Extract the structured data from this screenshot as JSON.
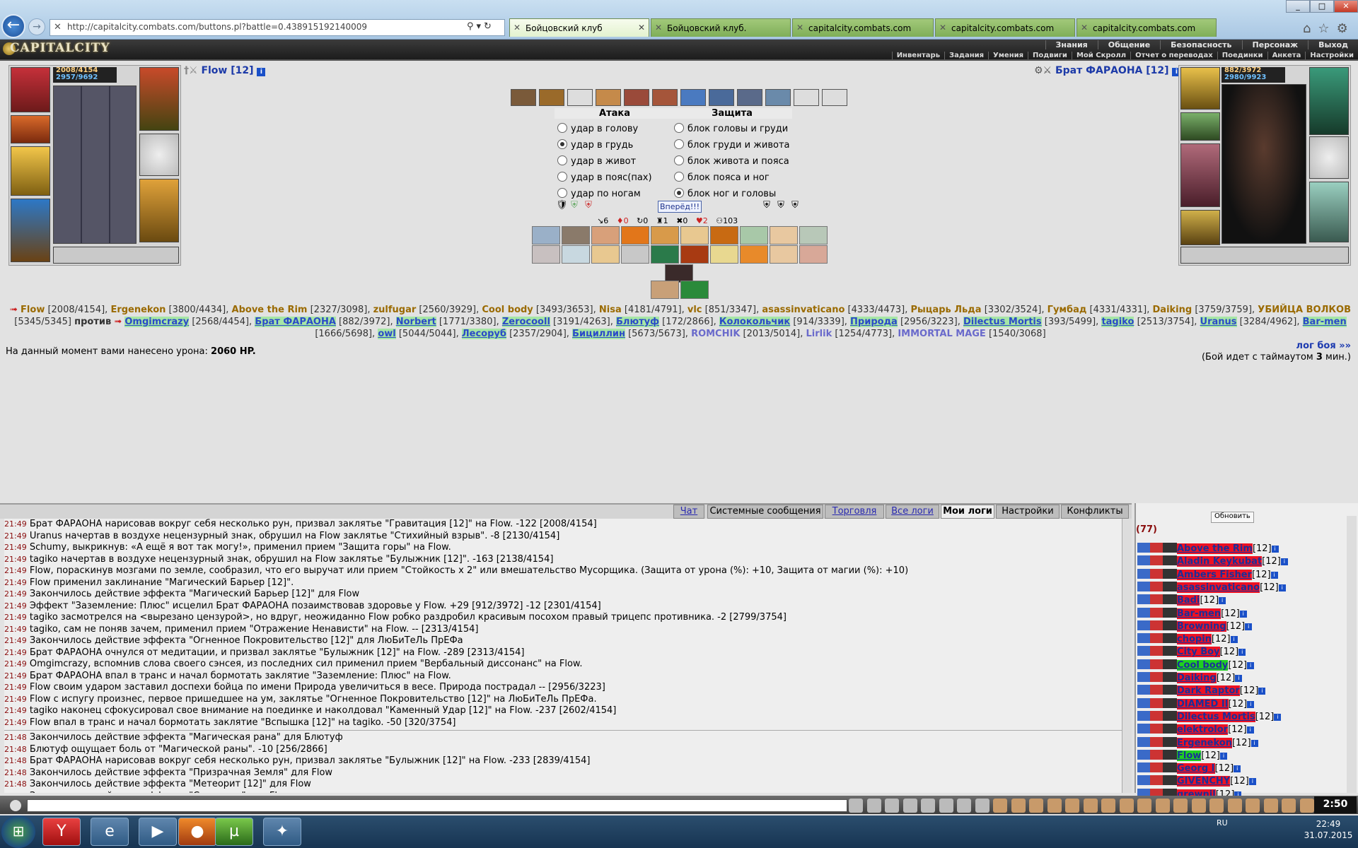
{
  "browser": {
    "url": "http://capitalcity.combats.com/buttons.pl?battle=0.438915192140009",
    "tabs": [
      "Бойцовский клуб",
      "Бойцовский клуб.",
      "capitalcity.combats.com",
      "capitalcity.combats.com",
      "capitalcity.combats.com"
    ]
  },
  "game": {
    "logo": "CAPITALCITY",
    "menu": [
      "Знания",
      "Общение",
      "Безопасность",
      "Персонаж",
      "Выход"
    ],
    "submenu": [
      "Инвентарь",
      "Задания",
      "Умения",
      "Подвиги",
      "Мой Скролл",
      "Отчет о переводах",
      "Поединки",
      "Анкета",
      "Настройки"
    ]
  },
  "left_char": {
    "name": "Flow [12]",
    "hp": "2008/4154",
    "mp": "2957/9692"
  },
  "right_char": {
    "name": "Брат ФАРАОНА [12]",
    "hp": "882/3972",
    "mp": "2980/9923"
  },
  "attack": {
    "attack_title": "Атака",
    "defense_title": "Защита",
    "attack_opts": [
      "удар в голову",
      "удар в грудь",
      "удар в живот",
      "удар в пояс(пах)",
      "удар по ногам"
    ],
    "defense_opts": [
      "блок головы и груди",
      "блок груди и живота",
      "блок живота и пояса",
      "блок пояса и ног",
      "блок ног и головы"
    ],
    "go": "Вперёд!!!",
    "attack_selected": 1,
    "defense_selected": 4,
    "stats": [
      "↘6",
      "♦0",
      "↻0",
      "♜1",
      "✖0",
      "♥2",
      "⚇103"
    ]
  },
  "teams": {
    "team1": [
      [
        "Flow",
        "[2008/4154]"
      ],
      [
        "Ergenekon",
        "[3800/4434]"
      ],
      [
        "Above the Rim",
        "[2327/3098]"
      ],
      [
        "zulfugar",
        "[2560/3929]"
      ],
      [
        "Cool body",
        "[3493/3653]"
      ],
      [
        "Nisa",
        "[4181/4791]"
      ],
      [
        "vlc",
        "[851/3347]"
      ],
      [
        "asassinvaticano",
        "[4333/4473]"
      ],
      [
        "Рыцарь Льда",
        "[3302/3524]"
      ],
      [
        "Гумбад",
        "[4331/4331]"
      ],
      [
        "Daiking",
        "[3759/3759]"
      ],
      [
        "УБИЙЦА ВОЛКОВ",
        "[5345/5345]"
      ]
    ],
    "vs": "против",
    "team2": [
      [
        "Omgimcrazy",
        "[2568/4454]"
      ],
      [
        "Брат ФАРАОНА",
        "[882/3972]"
      ],
      [
        "Norbert",
        "[1771/3380]"
      ],
      [
        "Zerocooll",
        "[3191/4263]"
      ],
      [
        "Блютуф",
        "[172/2866]"
      ],
      [
        "Колокольчик",
        "[914/3339]"
      ],
      [
        "Природа",
        "[2956/3223]"
      ],
      [
        "Dilectus Mortis",
        "[393/5499]"
      ],
      [
        "tagiko",
        "[2513/3754]"
      ],
      [
        "Uranus",
        "[3284/4962]"
      ],
      [
        "Bar-men",
        "[1666/5698]"
      ],
      [
        "owl",
        "[5044/5044]"
      ],
      [
        "Лесоруб",
        "[2357/2904]"
      ],
      [
        "Бициллин",
        "[5673/5673]"
      ],
      [
        "ROMCHIK",
        "[2013/5014]"
      ],
      [
        "Lirlik",
        "[1254/4773]"
      ],
      [
        "IMMORTAL MAGE",
        "[1540/3068]"
      ]
    ]
  },
  "damage": {
    "label": "На данный момент вами нанесено урона:",
    "value": "2060 HP."
  },
  "log_link": "лог боя »»",
  "timeout": {
    "text": "(Бой идет с таймаутом ",
    "num": "3",
    "unit": " мин.)"
  },
  "chat_tabs": [
    "Чат",
    "Системные сообщения",
    "Торговля",
    "Все логи",
    "Мои логи",
    "Настройки",
    "Конфликты"
  ],
  "chat_log": [
    [
      "21:49",
      "Брат ФАРАОНА нарисовав вокруг себя несколько рун, призвал заклятье \"Гравитация [12]\" на Flow. -122 [2008/4154]"
    ],
    [
      "21:49",
      "Uranus начертав в воздухе нецензурный знак, обрушил на Flow заклятье \"Стихийный взрыв\". -8 [2130/4154]"
    ],
    [
      "21:49",
      "Schumy, выкрикнув: «А ещё я вот так могу!», применил прием \"Защита горы\" на Flow."
    ],
    [
      "21:49",
      "tagiko начертав в воздухе нецензурный знак, обрушил на Flow заклятье \"Булыжник [12]\". -163 [2138/4154]"
    ],
    [
      "21:49",
      "Flow, пораскинув мозгами по земле, сообразил, что его выручат или прием \"Стойкость x 2\" или вмешательство Мусорщика. (Защита от урона (%): +10, Защита от магии (%): +10)"
    ],
    [
      "21:49",
      "Flow применил заклинание \"Магический Барьер [12]\"."
    ],
    [
      "21:49",
      "Закончилось действие эффекта \"Магический Барьер [12]\" для Flow"
    ],
    [
      "21:49",
      "Эффект \"Заземление: Плюс\" исцелил Брат ФАРАОНА позаимствовав здоровье у Flow. +29 [912/3972] -12 [2301/4154]"
    ],
    [
      "21:49",
      "tagiko засмотрелся на <вырезано цензурой>, но вдруг, неожиданно Flow робко раздробил красивым посохом правый трицепс противника. -2 [2799/3754]"
    ],
    [
      "21:49",
      "tagiko, сам не поняв зачем, применил прием \"Отражение Ненависти\" на Flow. -- [2313/4154]"
    ],
    [
      "21:49",
      "Закончилось действие эффекта \"Огненное Покровительство [12]\" для ЛюБиТеЛь ПрЕФа"
    ],
    [
      "21:49",
      "Брат ФАРАОНА очнулся от медитации, и призвал заклятье \"Булыжник [12]\" на Flow. -289 [2313/4154]"
    ],
    [
      "21:49",
      "Omgimcrazy, вспомнив слова своего сэнсея, из последних сил применил прием \"Вербальный диссонанс\" на Flow."
    ],
    [
      "21:49",
      "Брат ФАРАОНА впал в транс и начал бормотать заклятие \"Заземление: Плюс\" на Flow."
    ],
    [
      "21:49",
      "Flow своим ударом заставил доспехи бойца по имени Природа увеличиться в весе. Природа пострадал -- [2956/3223]"
    ],
    [
      "21:49",
      "Flow с испугу произнес, первое пришедшее на ум, заклятье \"Огненное Покровительство [12]\" на ЛюБиТеЛь ПрЕФа."
    ],
    [
      "21:49",
      "tagiko наконец сфокусировал свое внимание на поединке и наколдовал \"Каменный Удар [12]\" на Flow. -237 [2602/4154]"
    ],
    [
      "21:49",
      "Flow впал в транс и начал бормотать заклятие \"Вспышка [12]\" на tagiko. -50 [320/3754]"
    ],
    [
      "21:48",
      "Закончилось действие эффекта \"Магическая рана\" для Блютуф"
    ],
    [
      "21:48",
      "Блютуф ощущает боль от \"Магической раны\". -10 [256/2866]"
    ],
    [
      "21:48",
      "Брат ФАРАОНА нарисовав вокруг себя несколько рун, призвал заклятье \"Булыжник [12]\" на Flow. -233 [2839/4154]"
    ],
    [
      "21:48",
      "Закончилось действие эффекта \"Призрачная Земля\" для Flow"
    ],
    [
      "21:48",
      "Закончилось действие эффекта \"Метеорит [12]\" для Flow"
    ],
    [
      "21:48",
      "Закончилось действие эффекта \"Смирение\" для Flow"
    ]
  ],
  "who": {
    "refresh": "Обновить",
    "count": "(77)",
    "list": [
      [
        "Above the Rim",
        "[12]"
      ],
      [
        "Aladin Keykubat",
        "[12]"
      ],
      [
        "Ambers Fisher",
        "[12]"
      ],
      [
        "asassinvaticano",
        "[12]"
      ],
      [
        "Badi",
        "[12]"
      ],
      [
        "Bar-men",
        "[12]"
      ],
      [
        "Browning",
        "[12]"
      ],
      [
        "chopin",
        "[12]"
      ],
      [
        "City Boy",
        "[12]"
      ],
      [
        "Cool body",
        "[12]"
      ],
      [
        "Daiking",
        "[12]"
      ],
      [
        "Dark Raptor",
        "[12]"
      ],
      [
        "DIAMED II",
        "[12]"
      ],
      [
        "Dilectus Mortis",
        "[12]"
      ],
      [
        "elektrolor",
        "[12]"
      ],
      [
        "Ergenekon",
        "[12]"
      ],
      [
        "Flow",
        "[12]"
      ],
      [
        "Georg I",
        "[12]"
      ],
      [
        "GIVENCHY",
        "[12]"
      ],
      [
        "grewnil",
        "[12]"
      ]
    ]
  },
  "clock": "2:50",
  "tray": {
    "lang": "RU",
    "time": "22:49",
    "date": "31.07.2015"
  }
}
